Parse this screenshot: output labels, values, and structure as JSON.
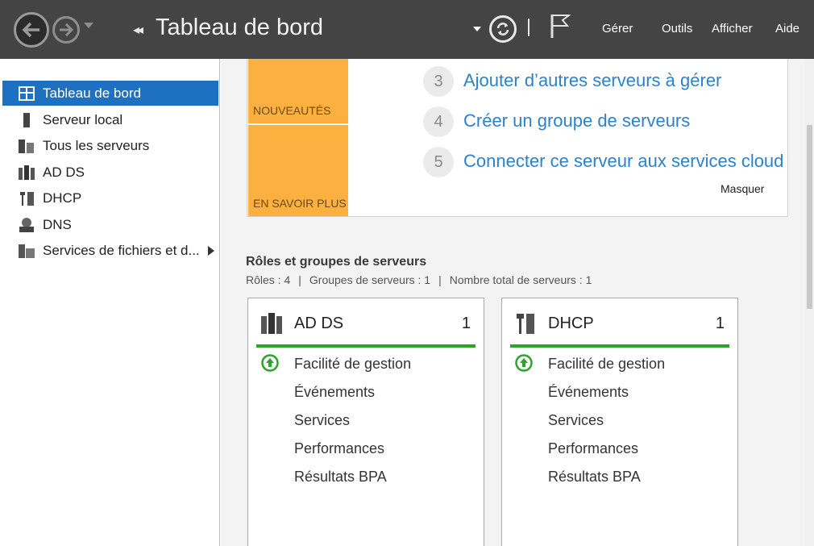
{
  "header": {
    "title": "Tableau de bord",
    "menu": [
      "Gérer",
      "Outils",
      "Afficher",
      "Aide"
    ]
  },
  "sidebar": {
    "items": [
      {
        "label": "Tableau de bord",
        "icon": "dashboard-icon",
        "active": true
      },
      {
        "label": "Serveur local",
        "icon": "local-server-icon"
      },
      {
        "label": "Tous les serveurs",
        "icon": "all-servers-icon"
      },
      {
        "label": "AD DS",
        "icon": "ad-ds-icon"
      },
      {
        "label": "DHCP",
        "icon": "dhcp-icon"
      },
      {
        "label": "DNS",
        "icon": "dns-icon"
      },
      {
        "label": "Services de fichiers et d...",
        "icon": "file-services-icon"
      }
    ]
  },
  "welcome": {
    "tiles": [
      "NOUVEAUTÉS",
      "EN SAVOIR PLUS"
    ],
    "steps": [
      {
        "number": "3",
        "text": "Ajouter d’autres serveurs à gérer"
      },
      {
        "number": "4",
        "text": "Créer un groupe de serveurs"
      },
      {
        "number": "5",
        "text": "Connecter ce serveur aux services cloud"
      }
    ],
    "hide_label": "Masquer"
  },
  "roles": {
    "title": "Rôles et groupes de serveurs",
    "stats": [
      "Rôles : 4",
      "Groupes de serveurs : 1",
      "Nombre total de serveurs : 1"
    ]
  },
  "cards": [
    {
      "title": "AD DS",
      "count": "1",
      "icon": "ad-ds-icon",
      "rows": [
        "Facilité de gestion",
        "Événements",
        "Services",
        "Performances",
        "Résultats BPA"
      ]
    },
    {
      "title": "DHCP",
      "count": "1",
      "icon": "dhcp-icon",
      "rows": [
        "Facilité de gestion",
        "Événements",
        "Services",
        "Performances",
        "Résultats BPA"
      ]
    }
  ],
  "colors": {
    "header_bg": "#444444",
    "accent_blue": "#1e70c0",
    "tile_orange": "#fbb040",
    "link_blue": "#2c82c9",
    "status_green": "#2aa52a"
  }
}
